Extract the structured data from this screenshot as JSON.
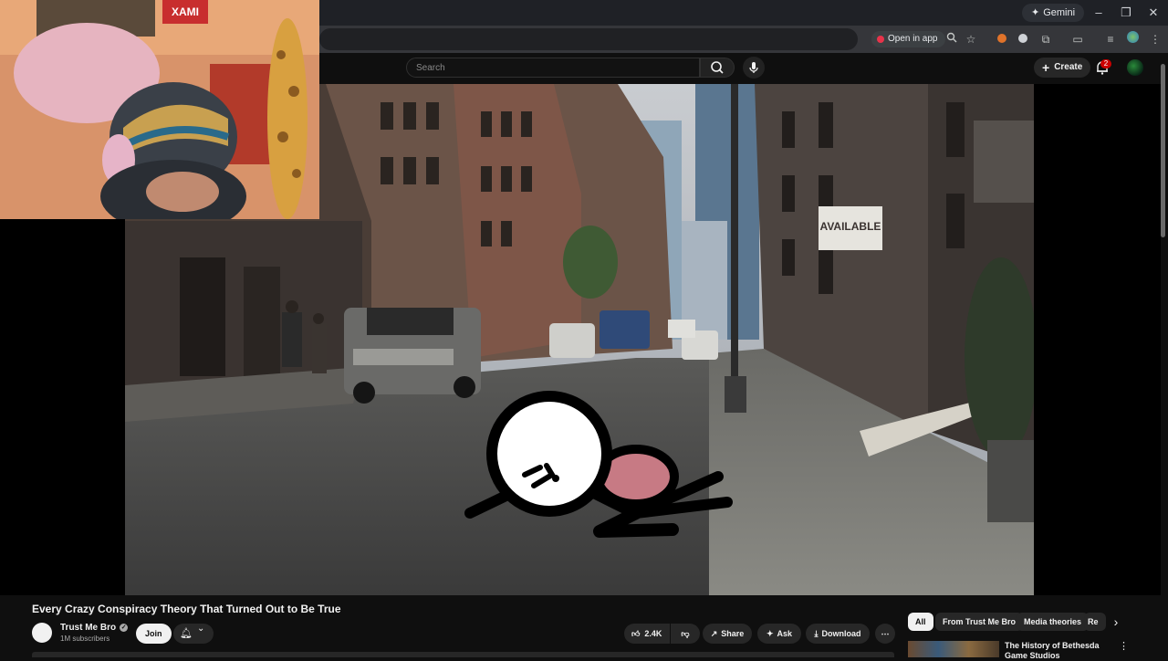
{
  "browser": {
    "gemini_label": "Gemini",
    "open_in_app_label": "Open in app",
    "window_controls": [
      "minimize",
      "restore",
      "close"
    ],
    "toolbar_icons": [
      "zoom-icon",
      "star-icon",
      "extension-icon",
      "puzzle-icon",
      "cast-icon",
      "reading-list-icon",
      "profile-icon",
      "menu-icon"
    ]
  },
  "youtube": {
    "search_placeholder": "Search",
    "create_label": "Create",
    "notification_count": "2",
    "video_title": "Every Crazy Conspiracy Theory That Turned Out to Be True",
    "channel_name": "Trust Me Bro",
    "subscribers": "1M subscribers",
    "join_label": "Join",
    "like_count": "2.4K",
    "share_label": "Share",
    "ask_label": "Ask",
    "download_label": "Download",
    "video_sign_text": "AVAILABLE",
    "webcam_sign_text": "XAMI",
    "chips": [
      "All",
      "From Trust Me Bro",
      "Media theories",
      "Re"
    ],
    "recommendation_title": "The History of Bethesda Game Studios"
  },
  "colors": {
    "background": "#0f0f0f",
    "accent_red": "#cc0000",
    "chip_active": "#f1f1f1"
  }
}
